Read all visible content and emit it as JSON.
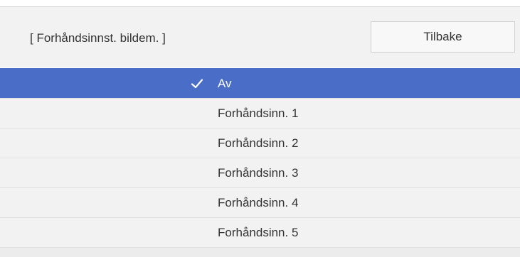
{
  "header": {
    "title": "[ Forhåndsinnst. bildem. ]",
    "back_label": "Tilbake"
  },
  "options": [
    {
      "label": "Av",
      "selected": true,
      "icon": "check-icon"
    },
    {
      "label": "Forhåndsinn. 1",
      "selected": false
    },
    {
      "label": "Forhåndsinn. 2",
      "selected": false
    },
    {
      "label": "Forhåndsinn. 3",
      "selected": false
    },
    {
      "label": "Forhåndsinn. 4",
      "selected": false
    },
    {
      "label": "Forhåndsinn. 5",
      "selected": false
    }
  ],
  "colors": {
    "selected_bg": "#4a6dc8",
    "row_bg": "#f2f2f2",
    "text": "#333333"
  }
}
